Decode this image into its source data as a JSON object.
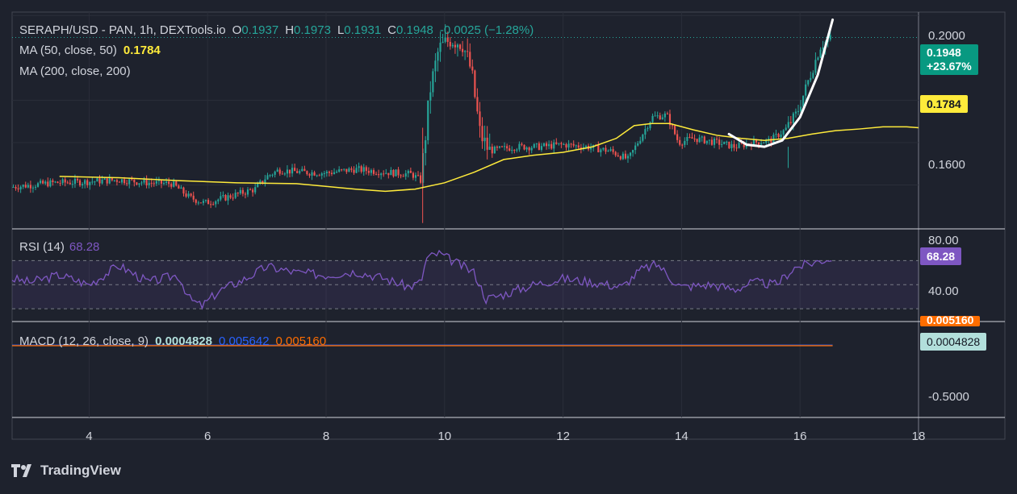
{
  "brand": {
    "name": "TradingView",
    "icon": "tradingview-logo-icon"
  },
  "legend": {
    "symbol": "SERAPH/USD - PAN, 1h, DEXTools.io",
    "o_label": "O",
    "o": "0.1937",
    "h_label": "H",
    "h": "0.1973",
    "l_label": "L",
    "l": "0.1931",
    "c_label": "C",
    "c": "0.1948",
    "change": "-0.0025 (−1.28%)",
    "ma50_label": "MA (50, close, 50)",
    "ma50_value": "0.1784",
    "ma200_label": "MA (200, close, 200)",
    "rsi_label": "RSI (14)",
    "rsi_value": "68.28",
    "macd_label": "MACD (12, 26, close, 9)",
    "macd_value": "0.0004828",
    "macd_signal": "0.005642",
    "macd_hist": "0.005160"
  },
  "price_axis": {
    "ticks": [
      "0.2000",
      "0.1600"
    ]
  },
  "price_labels": {
    "last": "0.1948",
    "change_pct": "+23.67%",
    "ma50": "0.1784"
  },
  "rsi_axis": {
    "ticks": [
      "80.00",
      "40.00"
    ],
    "current": "68.28"
  },
  "macd_axis": {
    "ticks": [
      "-0.5000"
    ],
    "current": "0.0004828",
    "hidden_top": "0.005160"
  },
  "time_axis": {
    "ticks": [
      "4",
      "6",
      "8",
      "10",
      "12",
      "14",
      "16",
      "18"
    ]
  },
  "colors": {
    "background": "#1e222d",
    "grid": "#2a2e39",
    "up": "#26a69a",
    "down": "#ef5350",
    "ma50": "#ffeb3b",
    "rsi": "#7e57c2",
    "macd": "#2962ff",
    "signal": "#ff6d00",
    "text": "#d1d4dc"
  },
  "chart_data": {
    "type": "candlestick",
    "price_range": [
      0.15,
      0.2008
    ],
    "x_range": [
      2.7,
      18
    ],
    "ma50_path": [
      [
        3.5,
        0.162
      ],
      [
        4.5,
        0.1617
      ],
      [
        5.5,
        0.161
      ],
      [
        6.5,
        0.1605
      ],
      [
        7.5,
        0.1603
      ],
      [
        8.5,
        0.159
      ],
      [
        9.0,
        0.1585
      ],
      [
        9.5,
        0.159
      ],
      [
        10.0,
        0.1605
      ],
      [
        10.5,
        0.163
      ],
      [
        11.0,
        0.166
      ],
      [
        11.5,
        0.167
      ],
      [
        12.0,
        0.1677
      ],
      [
        12.5,
        0.169
      ],
      [
        12.9,
        0.171
      ],
      [
        13.2,
        0.174
      ],
      [
        13.5,
        0.1745
      ],
      [
        13.8,
        0.1745
      ],
      [
        14.2,
        0.173
      ],
      [
        14.6,
        0.1717
      ],
      [
        15.0,
        0.171
      ],
      [
        15.4,
        0.1705
      ],
      [
        15.8,
        0.171
      ],
      [
        16.2,
        0.172
      ],
      [
        16.6,
        0.1728
      ],
      [
        17.0,
        0.1732
      ],
      [
        17.4,
        0.1737
      ],
      [
        17.8,
        0.1737
      ],
      [
        18.0,
        0.1735
      ]
    ],
    "curve_annotation": [
      [
        14.8,
        0.172
      ],
      [
        15.1,
        0.1695
      ],
      [
        15.4,
        0.169
      ],
      [
        15.7,
        0.1705
      ],
      [
        16.0,
        0.176
      ],
      [
        16.3,
        0.186
      ],
      [
        16.55,
        0.199
      ]
    ],
    "last_price": 0.1948,
    "ma50_last": 0.1784,
    "rsi": {
      "range": [
        20,
        95
      ],
      "levels": [
        70,
        50,
        30
      ],
      "path": [
        [
          2.7,
          55
        ],
        [
          3.0,
          52
        ],
        [
          3.5,
          58
        ],
        [
          4.0,
          50
        ],
        [
          4.5,
          66
        ],
        [
          5.0,
          52
        ],
        [
          5.5,
          58
        ],
        [
          5.7,
          38
        ],
        [
          5.9,
          32
        ],
        [
          6.2,
          45
        ],
        [
          6.6,
          54
        ],
        [
          7.0,
          65
        ],
        [
          7.5,
          60
        ],
        [
          8.0,
          58
        ],
        [
          8.5,
          61
        ],
        [
          9.0,
          55
        ],
        [
          9.4,
          48
        ],
        [
          9.6,
          52
        ],
        [
          9.7,
          72
        ],
        [
          9.9,
          76
        ],
        [
          10.2,
          68
        ],
        [
          10.5,
          60
        ],
        [
          10.7,
          38
        ],
        [
          11.0,
          42
        ],
        [
          11.5,
          50
        ],
        [
          12.0,
          55
        ],
        [
          12.5,
          52
        ],
        [
          13.0,
          48
        ],
        [
          13.3,
          62
        ],
        [
          13.6,
          67
        ],
        [
          13.8,
          56
        ],
        [
          14.0,
          48
        ],
        [
          14.5,
          50
        ],
        [
          14.9,
          46
        ],
        [
          15.2,
          52
        ],
        [
          15.6,
          50
        ],
        [
          15.9,
          64
        ],
        [
          16.2,
          68
        ],
        [
          16.5,
          72
        ],
        [
          16.55,
          68
        ]
      ]
    },
    "macd": {
      "range": [
        -0.8,
        0.25
      ],
      "zero": 0
    }
  }
}
